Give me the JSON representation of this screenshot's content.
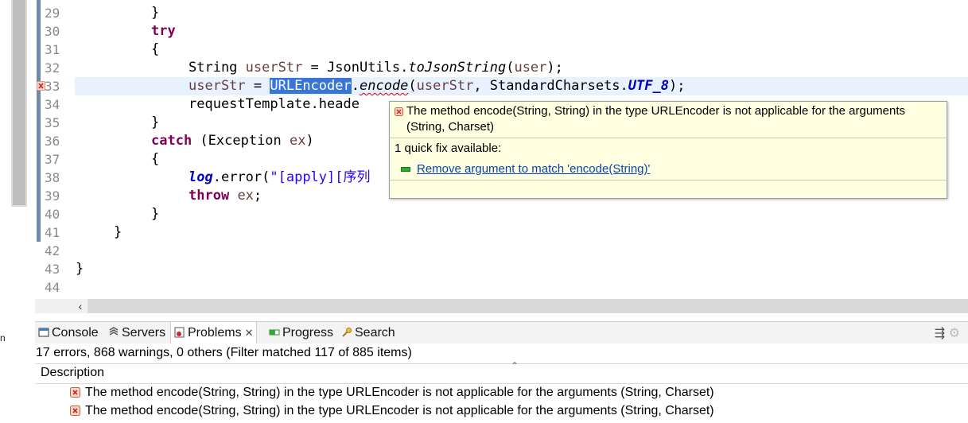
{
  "editor": {
    "lines": [
      {
        "no": "29",
        "current": false
      },
      {
        "no": "30",
        "current": false
      },
      {
        "no": "31",
        "current": false
      },
      {
        "no": "32",
        "current": false
      },
      {
        "no": "33",
        "current": true,
        "error": true
      },
      {
        "no": "34",
        "current": false
      },
      {
        "no": "35",
        "current": false
      },
      {
        "no": "36",
        "current": false
      },
      {
        "no": "37",
        "current": false
      },
      {
        "no": "38",
        "current": false
      },
      {
        "no": "39",
        "current": false
      },
      {
        "no": "40",
        "current": false
      },
      {
        "no": "41",
        "current": false
      },
      {
        "no": "42",
        "current": false
      },
      {
        "no": "43",
        "current": false
      },
      {
        "no": "44",
        "current": false
      }
    ],
    "code": {
      "l29": "}",
      "l30": "try",
      "l31": "{",
      "l32_type": "String ",
      "l32_var": "userStr",
      "l32_mid": " = JsonUtils.",
      "l32_method": "toJsonString",
      "l32_open": "(",
      "l32_arg": "user",
      "l32_end": ");",
      "l33_var": "userStr",
      "l33_eq": " = ",
      "l33_sel": "URLEncoder",
      "l33_dot": ".",
      "l33_method": "encode",
      "l33_open": "(",
      "l33_arg": "userStr",
      "l33_mid": ", StandardCharsets.",
      "l33_const": "UTF_8",
      "l33_end": ");",
      "l34": "requestTemplate.heade",
      "l35": "}",
      "l36_kw": "catch",
      "l36_rest1": " (Exception ",
      "l36_var": "ex",
      "l36_rest2": ")",
      "l37": "{",
      "l38_field": "log",
      "l38_mid": ".error(",
      "l38_str": "\"[apply][序列",
      "l39_kw": "throw",
      "l39_var": "ex",
      "l39_end": ";",
      "l40": "}",
      "l41": "}",
      "l43": "}"
    }
  },
  "hover": {
    "message": "The method encode(String, String) in the type URLEncoder is not applicable for the arguments (String, Charset)",
    "quick_fix_count": "1 quick fix available:",
    "fix_label": "Remove argument to match 'encode(String)'"
  },
  "left_fragment": "n",
  "views": {
    "tabs": [
      {
        "label": "Console",
        "icon": "console-icon"
      },
      {
        "label": "Servers",
        "icon": "servers-icon"
      },
      {
        "label": "Problems",
        "icon": "problems-icon",
        "active": true,
        "close": "✕"
      },
      {
        "label": "Progress",
        "icon": "progress-icon"
      },
      {
        "label": "Search",
        "icon": "search-icon"
      }
    ]
  },
  "problems": {
    "summary": "17 errors, 868 warnings, 0 others (Filter matched 117 of 885 items)",
    "column_description": "Description",
    "rows": [
      {
        "text": "The method encode(String, String) in the type URLEncoder is not applicable for the arguments (String, Charset)"
      },
      {
        "text": "The method encode(String, String) in the type URLEncoder is not applicable for the arguments (String, Charset)"
      }
    ]
  },
  "colors": {
    "keyword": "#7f0055",
    "selection": "#3875d7",
    "current_line": "#e8f2fe",
    "hover_bg": "#ffffe1",
    "link": "#0645ad"
  }
}
